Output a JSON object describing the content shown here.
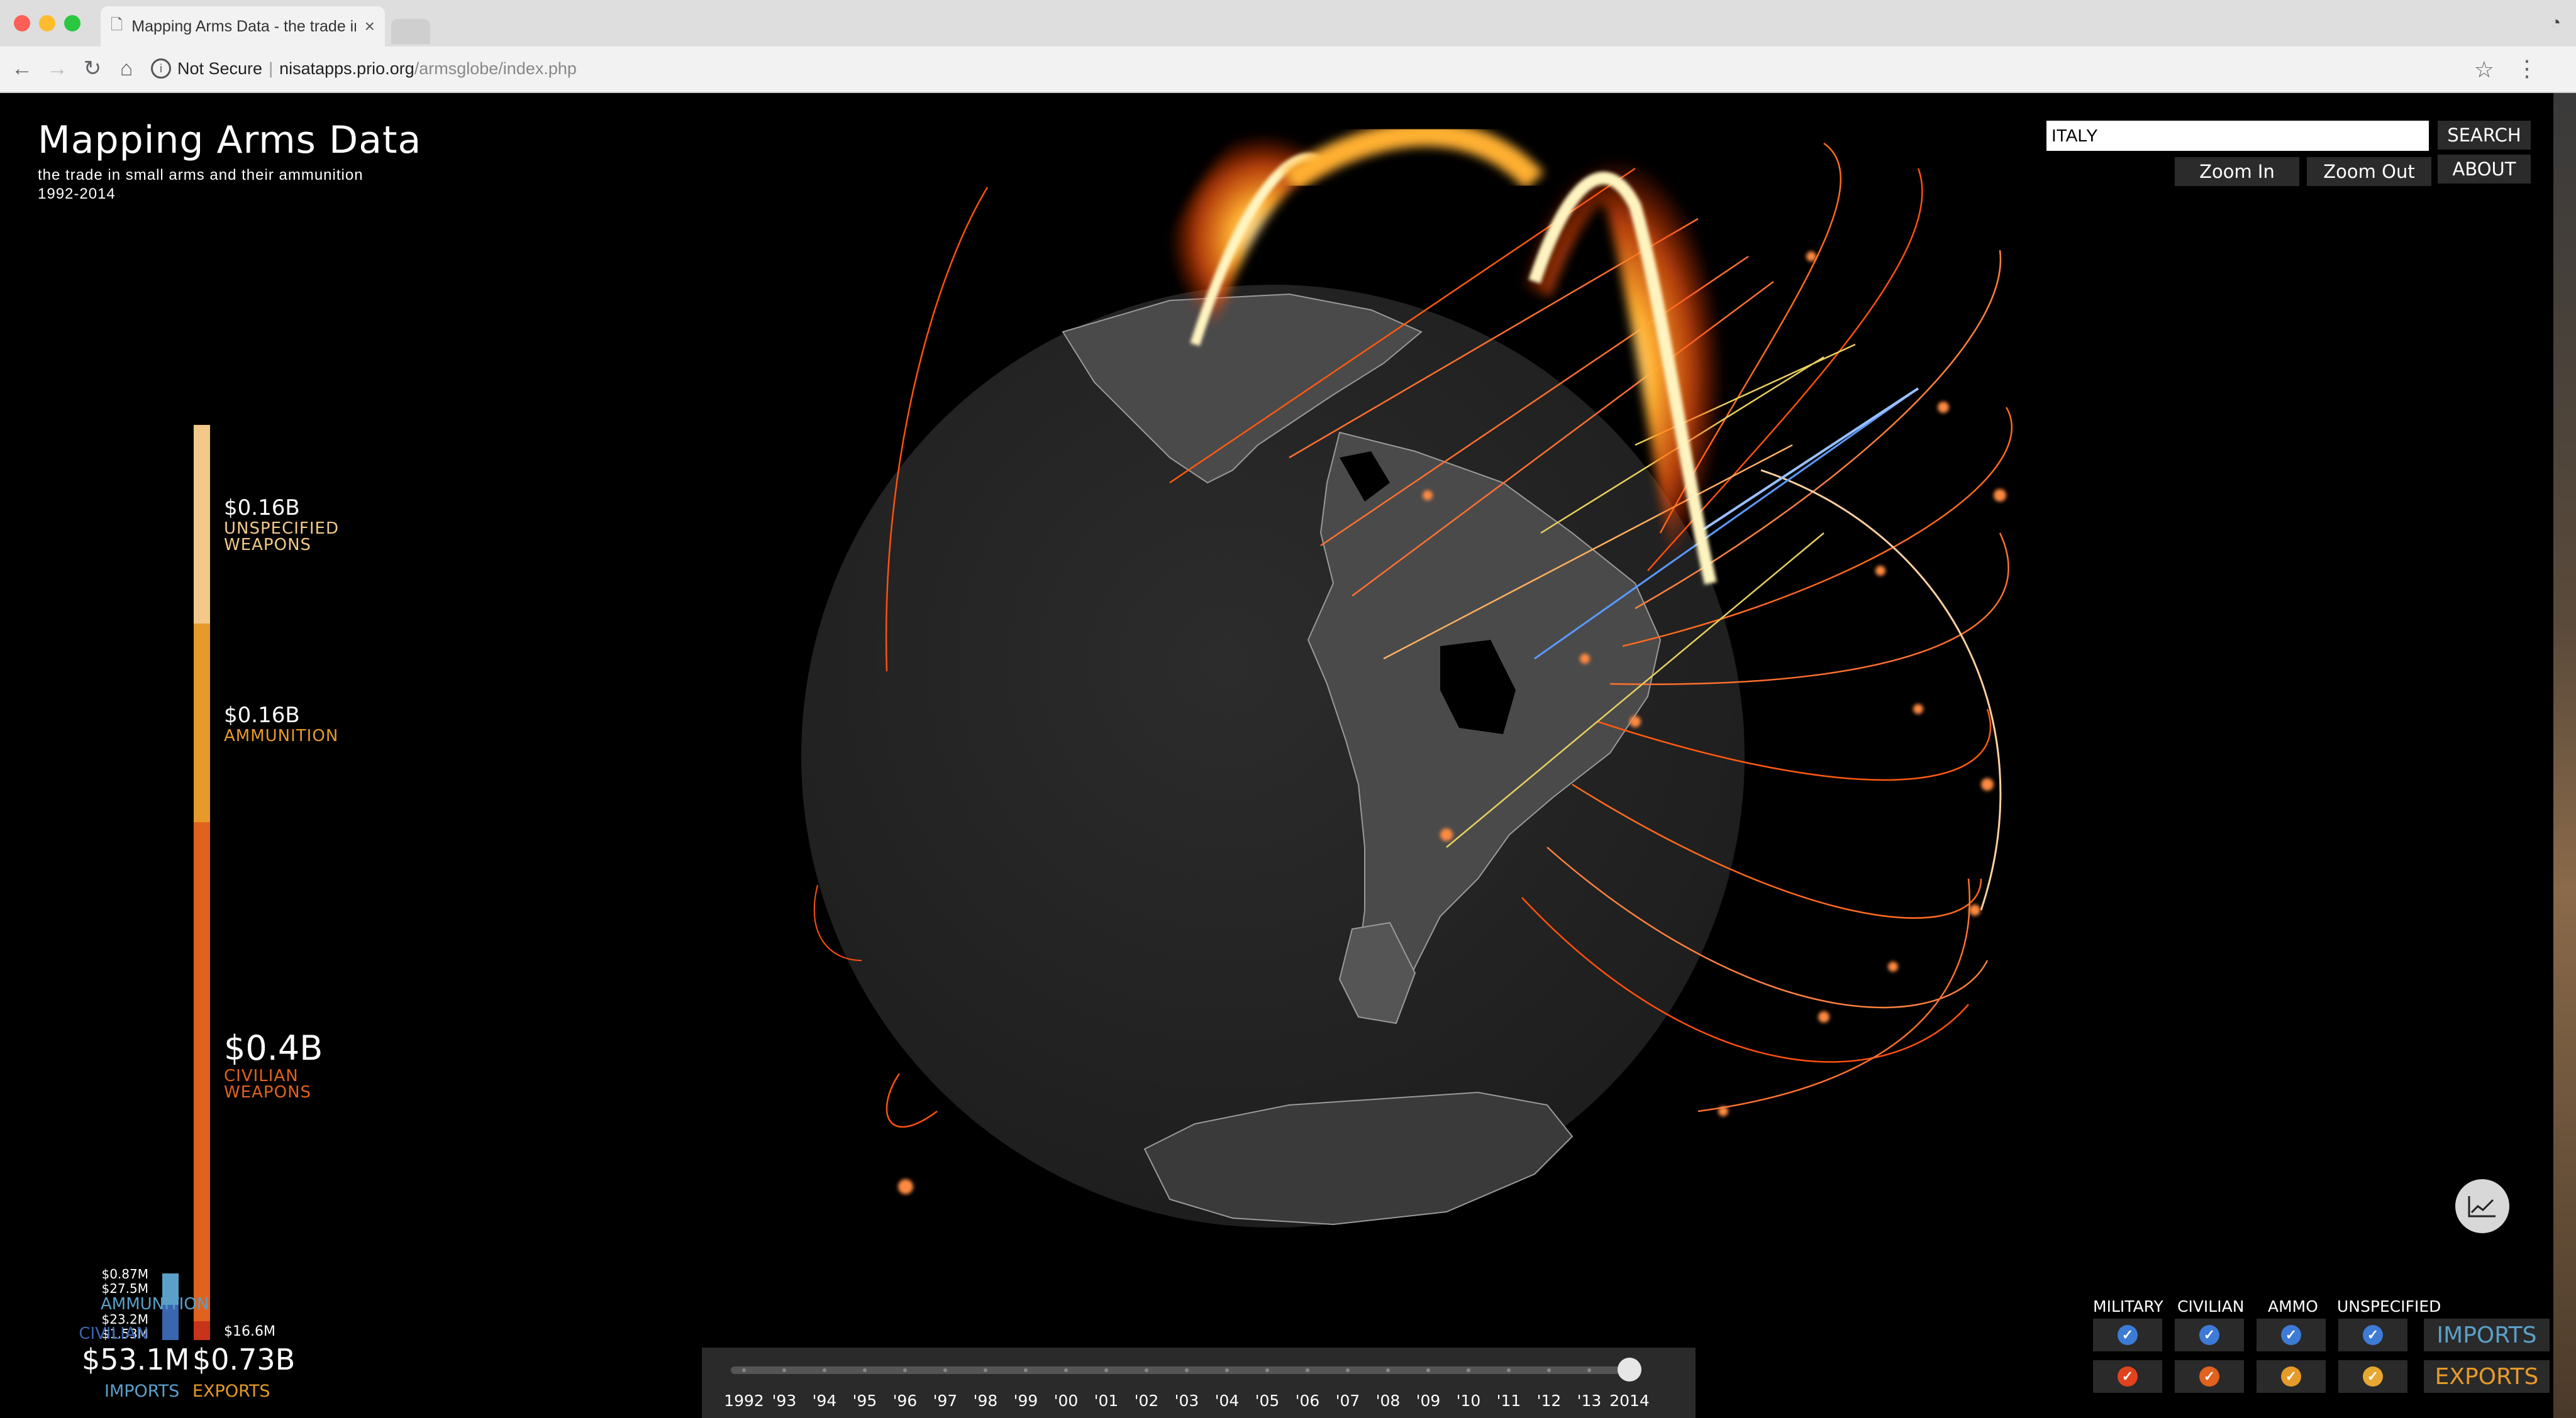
{
  "browser": {
    "tab_title": "Mapping Arms Data - the trade in small arms and their ammunition",
    "security_label": "Not Secure",
    "url_host": "nisatapps.prio.org",
    "url_path": "/armsglobe/index.php"
  },
  "app": {
    "title": "Mapping Arms Data",
    "subtitle": "the trade in small arms and their ammunition",
    "years": "1992-2014"
  },
  "search": {
    "value": "ITALY",
    "button": "SEARCH"
  },
  "controls": {
    "zoom_in": "Zoom In",
    "zoom_out": "Zoom Out",
    "about": "ABOUT"
  },
  "exports_bar": {
    "segments": [
      {
        "amount": "$0.16B",
        "label_1": "UNSPECIFIED",
        "label_2": "WEAPONS",
        "color": "#f2c98a"
      },
      {
        "amount": "$0.16B",
        "label_1": "AMMUNITION",
        "label_2": "",
        "color": "#e69a2a"
      },
      {
        "amount": "$0.4B",
        "label_1": "CIVILIAN",
        "label_2": "WEAPONS",
        "color": "#e0621e"
      },
      {
        "amount": "$16.6M",
        "label_1": "",
        "label_2": "",
        "color": "#c7341a"
      }
    ],
    "total": "$0.73B",
    "total_label": "EXPORTS"
  },
  "imports_bar": {
    "values": [
      "$0.87M",
      "$27.5M",
      "$23.2M",
      "$1.53M"
    ],
    "labels": [
      "AMMUNITION",
      "CIVILIAN"
    ],
    "total": "$53.1M",
    "total_label": "IMPORTS",
    "colors": {
      "ammunition": "#5aa0c8",
      "civilian": "#3a66b0"
    }
  },
  "timeline": {
    "years": [
      "1992",
      "'93",
      "'94",
      "'95",
      "'96",
      "'97",
      "'98",
      "'99",
      "'00",
      "'01",
      "'02",
      "'03",
      "'04",
      "'05",
      "'06",
      "'07",
      "'08",
      "'09",
      "'10",
      "'11",
      "'12",
      "'13",
      "2014"
    ],
    "selected": "2014"
  },
  "filters": {
    "headers": [
      "MILITARY",
      "CIVILIAN",
      "AMMO",
      "UNSPECIFIED"
    ],
    "imports_label": "IMPORTS",
    "exports_label": "EXPORTS",
    "import_color": "#3d7bd6",
    "export_colors": [
      "#e0431e",
      "#e0621e",
      "#e69a2a",
      "#e6a832"
    ]
  },
  "icons": {
    "chart": "line-chart-icon"
  }
}
